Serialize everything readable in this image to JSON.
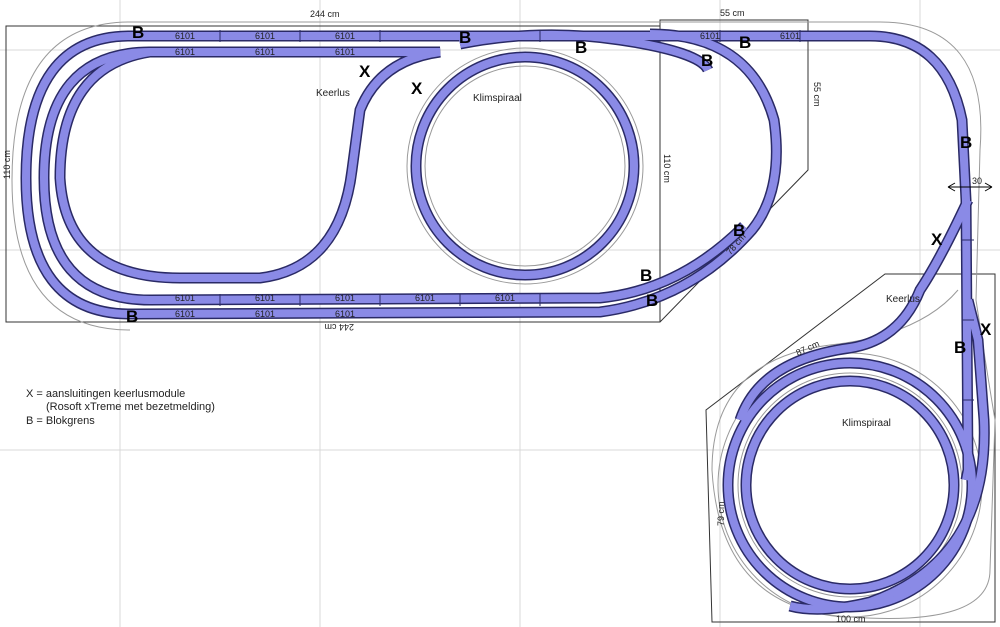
{
  "dimensions": {
    "top_length": "244 cm",
    "bottom_length": "244 cm",
    "left_height": "110 cm",
    "right_height": "110 cm",
    "corner_width": "55 cm",
    "corner_height": "55 cm",
    "diagonal_upper": "78 cm",
    "diagonal_lower": "87 cm",
    "lower_height": "79 cm",
    "lower_width": "100 cm",
    "arrow_label": "30"
  },
  "labels": {
    "keerlus_upper": "Keerlus",
    "klimspiraal_upper": "Klimspiraal",
    "keerlus_lower": "Keerlus",
    "klimspiraal_lower": "Klimspiraal"
  },
  "markers": {
    "block": "B",
    "connection": "X"
  },
  "legend": {
    "line1": "X = aansluitingen keerlusmodule",
    "line2": "(Rosoft xTreme met bezetmelding)",
    "line3": "B = Blokgrens"
  },
  "track_code": "6101",
  "colors": {
    "track_fill": "#8a8ae6",
    "track_outline": "#2a2a66",
    "grid": "#d9d9d9"
  }
}
